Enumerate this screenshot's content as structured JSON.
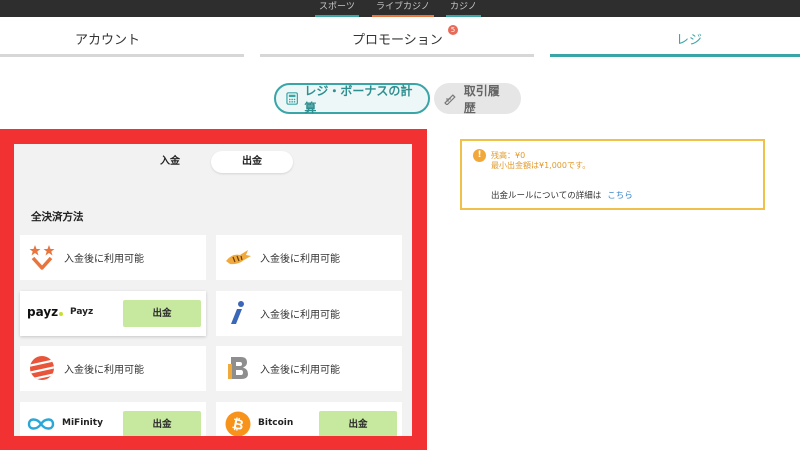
{
  "top_nav": {
    "items": [
      {
        "label": "スポーツ"
      },
      {
        "label": "ライブカジノ"
      },
      {
        "label": "カジノ"
      }
    ]
  },
  "tabs": [
    {
      "label": "アカウント"
    },
    {
      "label": "プロモーション",
      "badge": "5"
    },
    {
      "label": "レジ"
    }
  ],
  "actions": {
    "calc_label": "レジ・ボーナスの計算",
    "history_label": "取引履歴"
  },
  "toggle": {
    "deposit": "入金",
    "withdraw": "出金"
  },
  "section_title": "全決済方法",
  "methods": [
    {
      "icon": "star-chevron-icon",
      "text": "入金後に利用可能"
    },
    {
      "icon": "tiger-icon",
      "text": "入金後に利用可能"
    },
    {
      "icon": "payz-logo",
      "logo_text": "payz",
      "name": "Payz",
      "button": "出金"
    },
    {
      "icon": "i-logo-icon",
      "text": "入金後に利用可能"
    },
    {
      "icon": "striped-circle-icon",
      "text": "入金後に利用可能"
    },
    {
      "icon": "b-logo-icon",
      "text": "入金後に利用可能"
    },
    {
      "icon": "mifinity-logo-icon",
      "name": "MiFinity",
      "button": "出金"
    },
    {
      "icon": "bitcoin-icon",
      "name": "Bitcoin",
      "button": "出金"
    }
  ],
  "info": {
    "balance": "残高：¥0",
    "min_withdraw": "最小出金額は¥1,000です。",
    "rule_text": "出金ルールについての詳細は",
    "rule_link": "こちら"
  },
  "colors": {
    "accent": "#3aa5a6",
    "highlight_frame": "#f23232",
    "withdraw_button": "#c6e89f",
    "warning": "#f0c04a",
    "badge": "#e86a59"
  }
}
